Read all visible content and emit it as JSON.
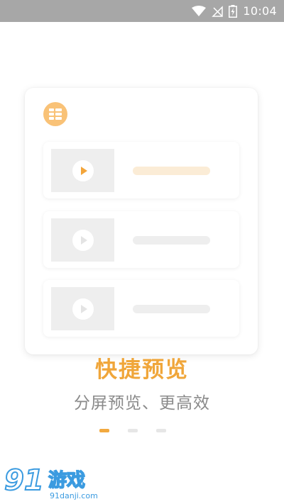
{
  "status_bar": {
    "time": "10:04",
    "icons": [
      "wifi-icon",
      "signal-off-icon",
      "battery-charging-icon"
    ]
  },
  "onboarding": {
    "title": "快捷预览",
    "subtitle": "分屏预览、更高效",
    "page_count": 3,
    "active_page": 1
  },
  "illustration": {
    "rows": [
      {
        "state": "active"
      },
      {
        "state": "inactive"
      },
      {
        "state": "inactive"
      }
    ],
    "colors": {
      "accent": "#f0a63a",
      "accent_light": "#fbecd6",
      "placeholder": "#eeeeee"
    }
  },
  "watermark": {
    "logo_text": "91",
    "brand": "游戏",
    "url": "91danji.com"
  }
}
